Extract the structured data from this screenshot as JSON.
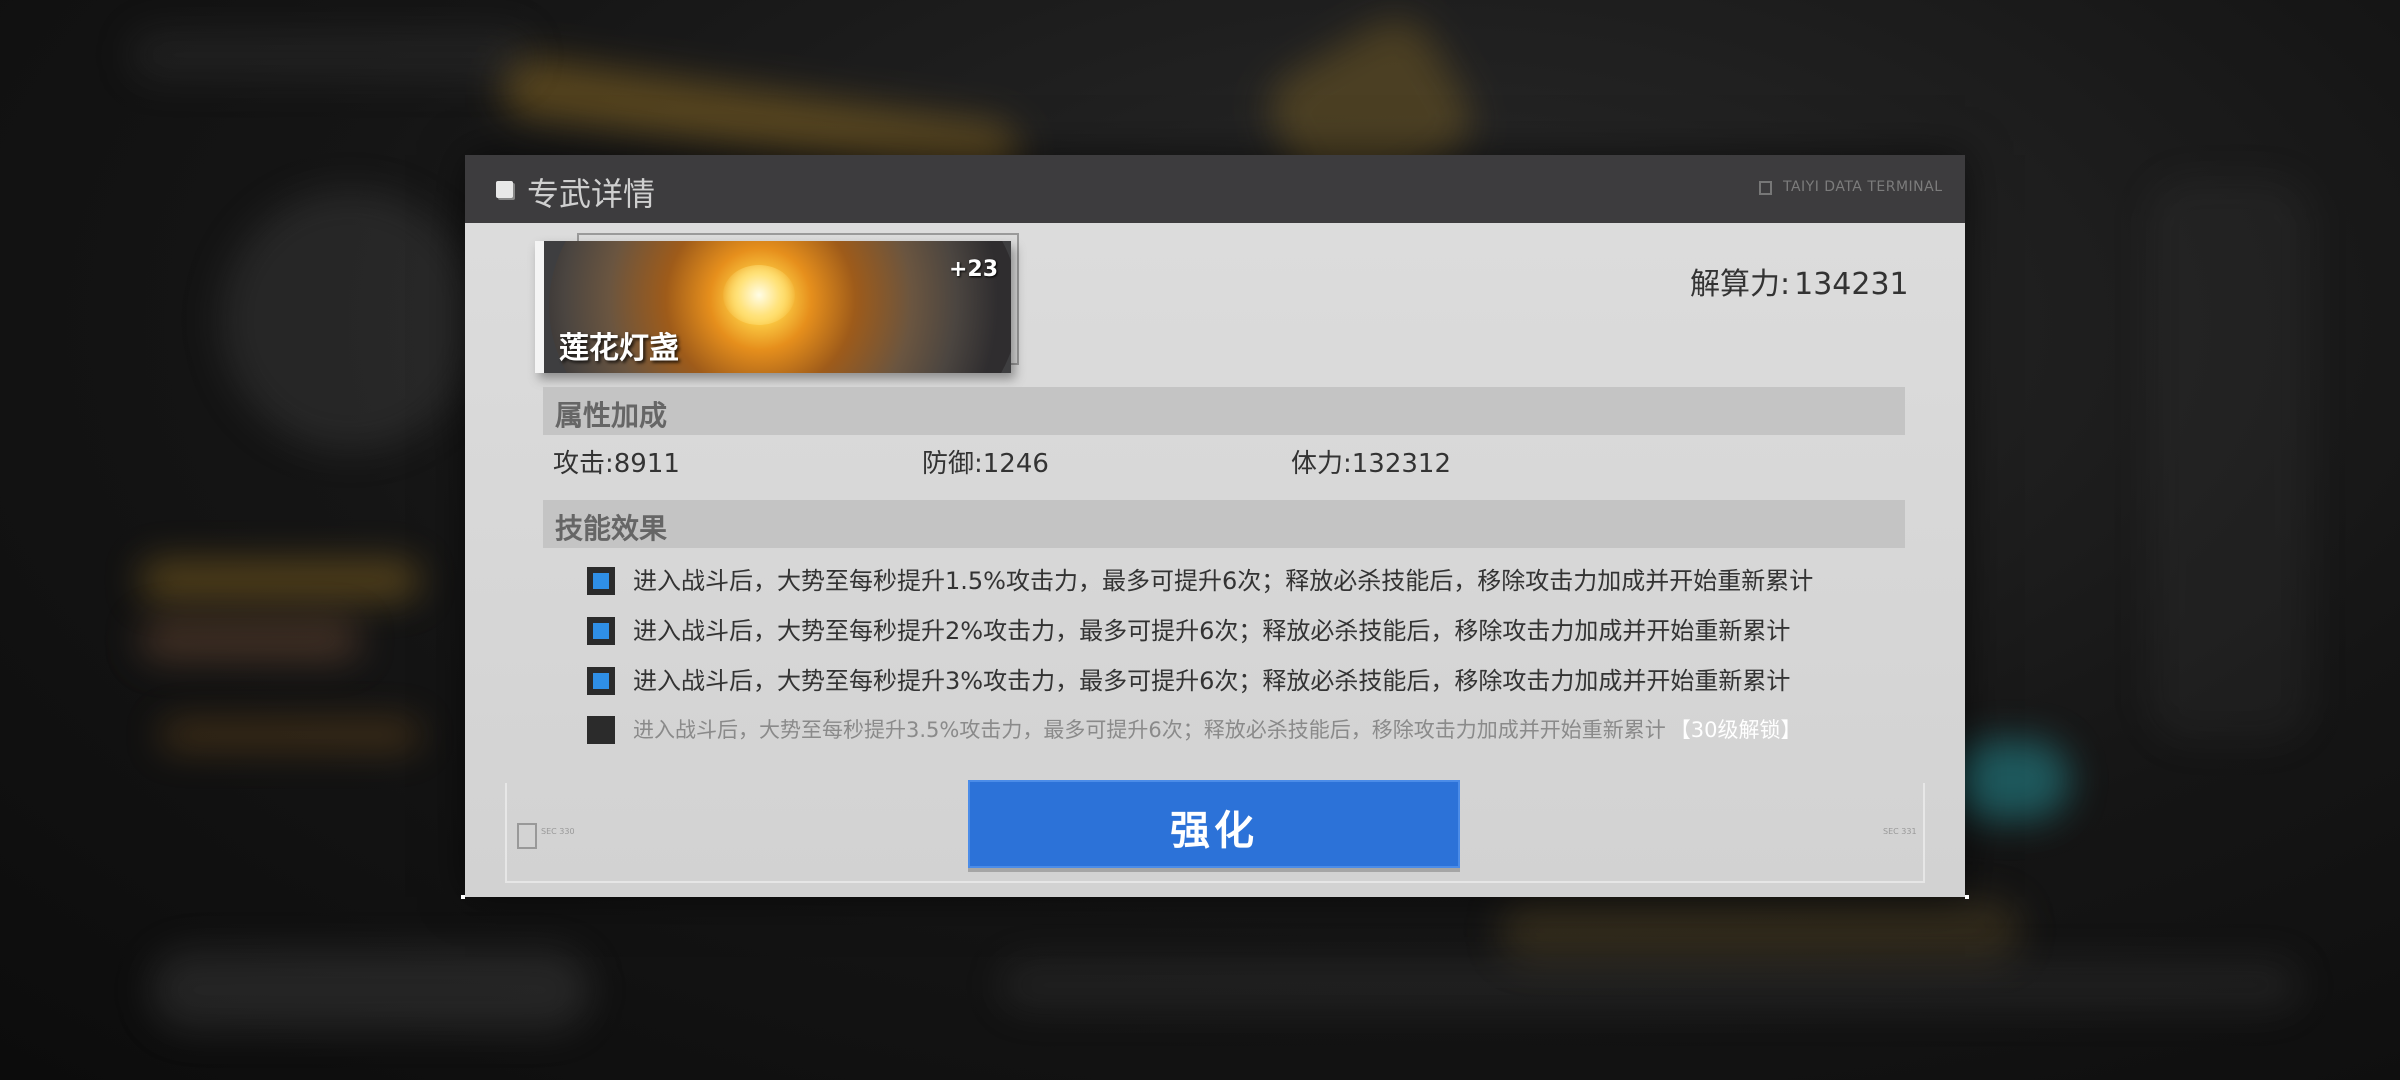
{
  "dialog": {
    "title": "专武详情",
    "terminal_label": "TAIYI DATA TERMINAL"
  },
  "weapon": {
    "name": "莲花灯盏",
    "level_bonus": "+23"
  },
  "power": {
    "label": "解算力:",
    "value": "134231"
  },
  "attributes": {
    "header": "属性加成",
    "items": [
      {
        "label": "攻击:",
        "value": "8911"
      },
      {
        "label": "防御:",
        "value": "1246"
      },
      {
        "label": "体力:",
        "value": "132312"
      }
    ]
  },
  "skills": {
    "header": "技能效果",
    "items": [
      {
        "text": "进入战斗后，大势至每秒提升1.5%攻击力，最多可提升6次；释放必杀技能后，移除攻击力加成并开始重新累计",
        "unlocked": true
      },
      {
        "text": "进入战斗后，大势至每秒提升2%攻击力，最多可提升6次；释放必杀技能后，移除攻击力加成并开始重新累计",
        "unlocked": true
      },
      {
        "text": "进入战斗后，大势至每秒提升3%攻击力，最多可提升6次；释放必杀技能后，移除攻击力加成并开始重新累计",
        "unlocked": true
      },
      {
        "text": "进入战斗后，大势至每秒提升3.5%攻击力，最多可提升6次；释放必杀技能后，移除攻击力加成并开始重新累计",
        "unlocked": false,
        "lock_note": "【30级解锁】"
      }
    ]
  },
  "actions": {
    "enhance_label": "强化"
  },
  "footer": {
    "left_code": "SEC 330",
    "right_code": "SEC 331"
  },
  "colors": {
    "accent_blue": "#2c72d8",
    "checkbox_on": "#2f8fe6",
    "header_bg": "#3d3c3e"
  }
}
